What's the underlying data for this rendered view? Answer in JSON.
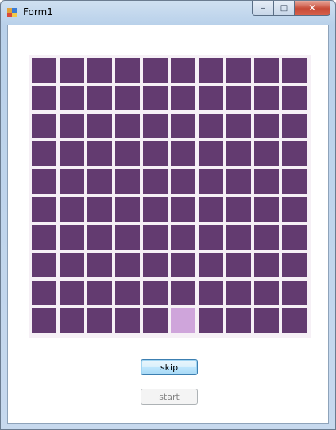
{
  "window": {
    "title": "Form1",
    "icon": "form-app-icon",
    "controls": {
      "minimize": "–",
      "maximize": "□",
      "close": "✕"
    }
  },
  "board": {
    "rows": 10,
    "columns": 10,
    "cell_color": "#633b70",
    "highlight_color": "#cfa5db",
    "background_color": "#f6f0f6",
    "highlighted_cell": {
      "row": 10,
      "column": 6
    }
  },
  "buttons": {
    "skip_label": "skip",
    "start_label": "start",
    "start_enabled": false
  }
}
